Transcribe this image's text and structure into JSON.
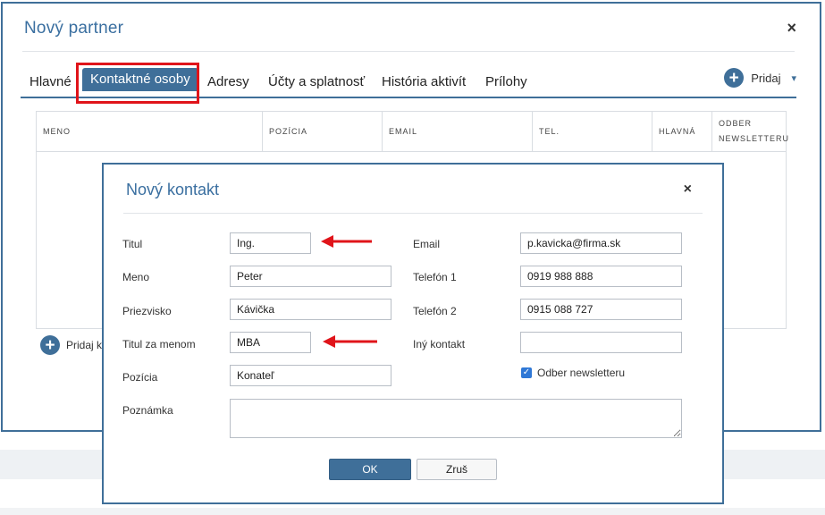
{
  "outer_dialog": {
    "title": "Nový partner",
    "close": "×",
    "tabs": [
      {
        "label": "Hlavné"
      },
      {
        "label": "Kontaktné osoby"
      },
      {
        "label": "Adresy"
      },
      {
        "label": "Účty a splatnosť"
      },
      {
        "label": "História aktivít"
      },
      {
        "label": "Prílohy"
      }
    ],
    "active_tab": "Kontaktné osoby",
    "add_button": {
      "icon": "+",
      "label": "Pridaj",
      "caret": "▾"
    },
    "table": {
      "columns": [
        "MENO",
        "POZÍCIA",
        "EMAIL",
        "TEL.",
        "HLAVNÁ",
        "ODBER NEWSLETTERU"
      ]
    },
    "add_contact_link": {
      "icon": "+",
      "label": "Pridaj k"
    }
  },
  "inner_dialog": {
    "title": "Nový kontakt",
    "close": "×",
    "fields": {
      "titul": {
        "label": "Titul",
        "value": "Ing."
      },
      "meno": {
        "label": "Meno",
        "value": "Peter"
      },
      "priezvisko": {
        "label": "Priezvisko",
        "value": "Kávička"
      },
      "titul_za": {
        "label": "Titul za menom",
        "value": "MBA"
      },
      "pozicia": {
        "label": "Pozícia",
        "value": "Konateľ"
      },
      "poznamka": {
        "label": "Poznámka",
        "value": ""
      },
      "email": {
        "label": "Email",
        "value": "p.kavicka@firma.sk"
      },
      "telefon1": {
        "label": "Telefón 1",
        "value": "0919 988 888"
      },
      "telefon2": {
        "label": "Telefón 2",
        "value": "0915 088 727"
      },
      "iny_kontakt": {
        "label": "Iný kontakt",
        "value": ""
      }
    },
    "newsletter": {
      "label": "Odber newsletteru",
      "checked": true,
      "check_glyph": "✓"
    },
    "buttons": {
      "ok": "OK",
      "cancel": "Zruš"
    }
  },
  "colors": {
    "accent": "#3f6f99",
    "highlight": "#e0141a",
    "checkbox": "#2f78d6"
  }
}
